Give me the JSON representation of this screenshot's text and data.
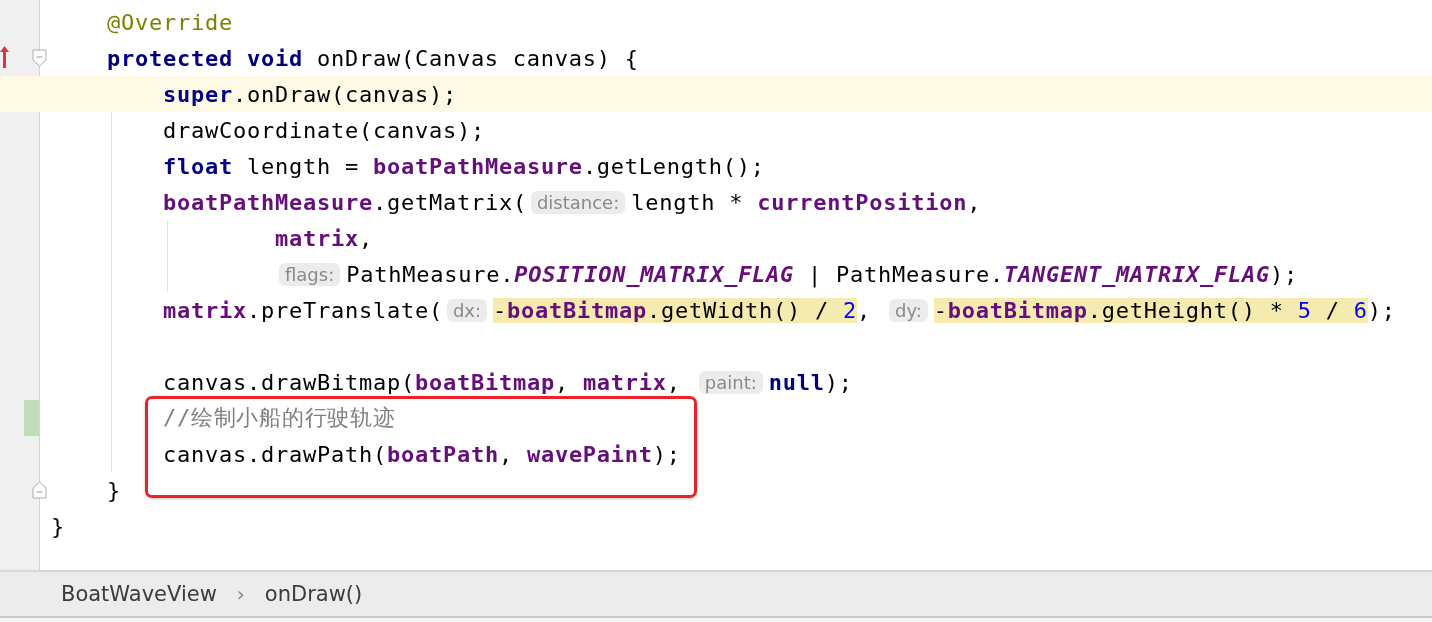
{
  "editor": {
    "lines": [
      {
        "children": [
          {
            "tokens": [
              {
                "kind": "annotation",
                "text": "@Override"
              }
            ]
          },
          {
            "overridden": true,
            "fold_start": true,
            "tokens": [
              {
                "kind": "keyword",
                "text": "protected void"
              },
              {
                "kind": "plain",
                "text": " onDraw(Canvas canvas) {"
              }
            ],
            "children": [
              {
                "current": true,
                "tokens": [
                  {
                    "kind": "keyword",
                    "text": "super"
                  },
                  {
                    "kind": "plain",
                    "text": ".onDraw(canvas);"
                  }
                ]
              },
              {
                "tokens": [
                  {
                    "kind": "plain",
                    "text": "drawCoordinate(canvas);"
                  }
                ]
              },
              {
                "tokens": [
                  {
                    "kind": "keyword",
                    "text": "float"
                  },
                  {
                    "kind": "plain",
                    "text": " length = "
                  },
                  {
                    "kind": "field",
                    "text": "boatPathMeasure"
                  },
                  {
                    "kind": "plain",
                    "text": ".getLength();"
                  }
                ]
              },
              {
                "tokens": [
                  {
                    "kind": "field",
                    "text": "boatPathMeasure"
                  },
                  {
                    "kind": "plain",
                    "text": ".getMatrix("
                  },
                  {
                    "kind": "hint",
                    "text": "distance:"
                  },
                  {
                    "kind": "plain",
                    "text": "length * "
                  },
                  {
                    "kind": "field",
                    "text": "currentPosition"
                  },
                  {
                    "kind": "plain",
                    "text": ","
                  }
                ],
                "children": [
                  {
                    "continuation": true,
                    "tokens": [
                      {
                        "kind": "field",
                        "text": "matrix"
                      },
                      {
                        "kind": "plain",
                        "text": ","
                      }
                    ]
                  },
                  {
                    "continuation": true,
                    "tokens": [
                      {
                        "kind": "hint",
                        "text": "flags:"
                      },
                      {
                        "kind": "plain",
                        "text": "PathMeasure."
                      },
                      {
                        "kind": "static",
                        "text": "POSITION_MATRIX_FLAG"
                      },
                      {
                        "kind": "plain",
                        "text": " | PathMeasure."
                      },
                      {
                        "kind": "static",
                        "text": "TANGENT_MATRIX_FLAG"
                      },
                      {
                        "kind": "plain",
                        "text": ");"
                      }
                    ]
                  }
                ]
              },
              {
                "tokens": [
                  {
                    "kind": "field",
                    "text": "matrix",
                    "highlight": false
                  },
                  {
                    "kind": "plain",
                    "text": ".preTranslate(",
                    "highlight": false
                  },
                  {
                    "kind": "hint",
                    "text": "dx:"
                  },
                  {
                    "kind": "plain",
                    "text": "-",
                    "highlight": true
                  },
                  {
                    "kind": "field",
                    "text": "boatBitmap",
                    "highlight": true
                  },
                  {
                    "kind": "plain",
                    "text": ".getWidth() / ",
                    "highlight": true
                  },
                  {
                    "kind": "number",
                    "text": "2",
                    "highlight": true
                  },
                  {
                    "kind": "plain",
                    "text": ", ",
                    "highlight": false
                  },
                  {
                    "kind": "hint",
                    "text": "dy:"
                  },
                  {
                    "kind": "plain",
                    "text": "-",
                    "highlight": true
                  },
                  {
                    "kind": "field",
                    "text": "boatBitmap",
                    "highlight": true
                  },
                  {
                    "kind": "plain",
                    "text": ".getHeight() * ",
                    "highlight": true
                  },
                  {
                    "kind": "number",
                    "text": "5",
                    "highlight": true
                  },
                  {
                    "kind": "plain",
                    "text": " / ",
                    "highlight": true
                  },
                  {
                    "kind": "number",
                    "text": "6",
                    "highlight": true
                  },
                  {
                    "kind": "plain",
                    "text": ");",
                    "highlight": false
                  }
                ]
              },
              {
                "blank": true
              },
              {
                "tokens": [
                  {
                    "kind": "plain",
                    "text": "canvas.drawBitmap("
                  },
                  {
                    "kind": "field",
                    "text": "boatBitmap"
                  },
                  {
                    "kind": "plain",
                    "text": ", "
                  },
                  {
                    "kind": "field",
                    "text": "matrix"
                  },
                  {
                    "kind": "plain",
                    "text": ", "
                  },
                  {
                    "kind": "hint",
                    "text": "paint:"
                  },
                  {
                    "kind": "keyword",
                    "text": "null"
                  },
                  {
                    "kind": "plain",
                    "text": ");"
                  }
                ]
              },
              {
                "changed": true,
                "boxed": true,
                "tokens": [
                  {
                    "kind": "comment",
                    "text": "//绘制小船的行驶轨迹"
                  }
                ]
              },
              {
                "boxed": true,
                "tokens": [
                  {
                    "kind": "plain",
                    "text": "canvas.drawPath("
                  },
                  {
                    "kind": "field",
                    "text": "boatPath"
                  },
                  {
                    "kind": "plain",
                    "text": ", "
                  },
                  {
                    "kind": "field",
                    "text": "wavePaint"
                  },
                  {
                    "kind": "plain",
                    "text": ");"
                  }
                ]
              }
            ]
          },
          {
            "fold_end": true,
            "tokens": [
              {
                "kind": "plain",
                "text": "}"
              }
            ]
          }
        ]
      },
      {
        "tokens": [
          {
            "kind": "plain",
            "text": "}"
          }
        ]
      }
    ]
  },
  "breadcrumb": [
    {
      "kind": "item",
      "text": "BoatWaveView"
    },
    {
      "kind": "separator",
      "text": "›"
    },
    {
      "kind": "item",
      "text": "onDraw()"
    }
  ]
}
